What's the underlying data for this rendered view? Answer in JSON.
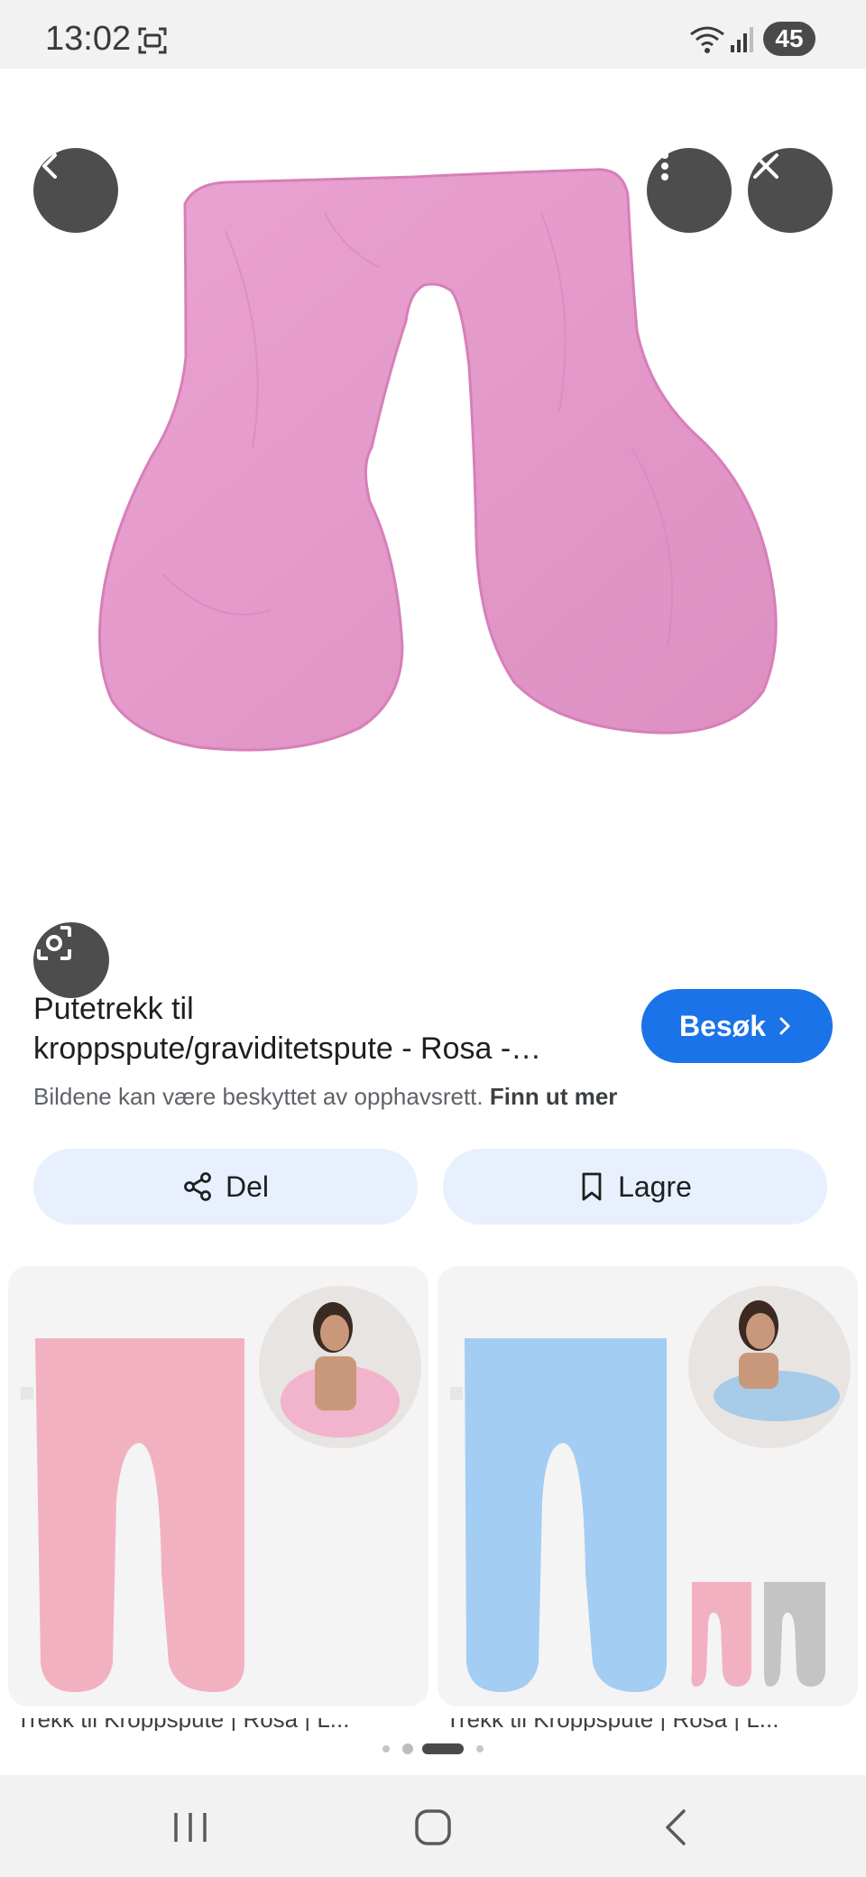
{
  "status_bar": {
    "time": "13:02",
    "battery": "45",
    "icons": [
      "screenshot-icon",
      "wifi-icon",
      "signal-icon"
    ]
  },
  "toolbar": {
    "back_icon": "chevron-left-icon",
    "more_icon": "more-vert-icon",
    "close_icon": "close-icon",
    "lens_icon": "lens-icon"
  },
  "product": {
    "title_line1": "Putetrekk til",
    "title_line2": "kroppspute/graviditetspute - Rosa -…",
    "visit_label": "Besøk",
    "copyright_text": "Bildene kan være beskyttet av opphavsrett.",
    "learn_more": "Finn ut mer"
  },
  "actions": {
    "share_label": "Del",
    "save_label": "Lagre"
  },
  "related": [
    {
      "caption": "Trekk til Kroppspute | Rosa | L..."
    },
    {
      "caption": "Trekk til Kroppspute | Rosa | L..."
    }
  ],
  "colors": {
    "accent": "#1a73e8",
    "chip_bg": "#e8f0fe",
    "pillow_pink": "#e59ac9",
    "pillow_blue": "#9cc6ef"
  }
}
